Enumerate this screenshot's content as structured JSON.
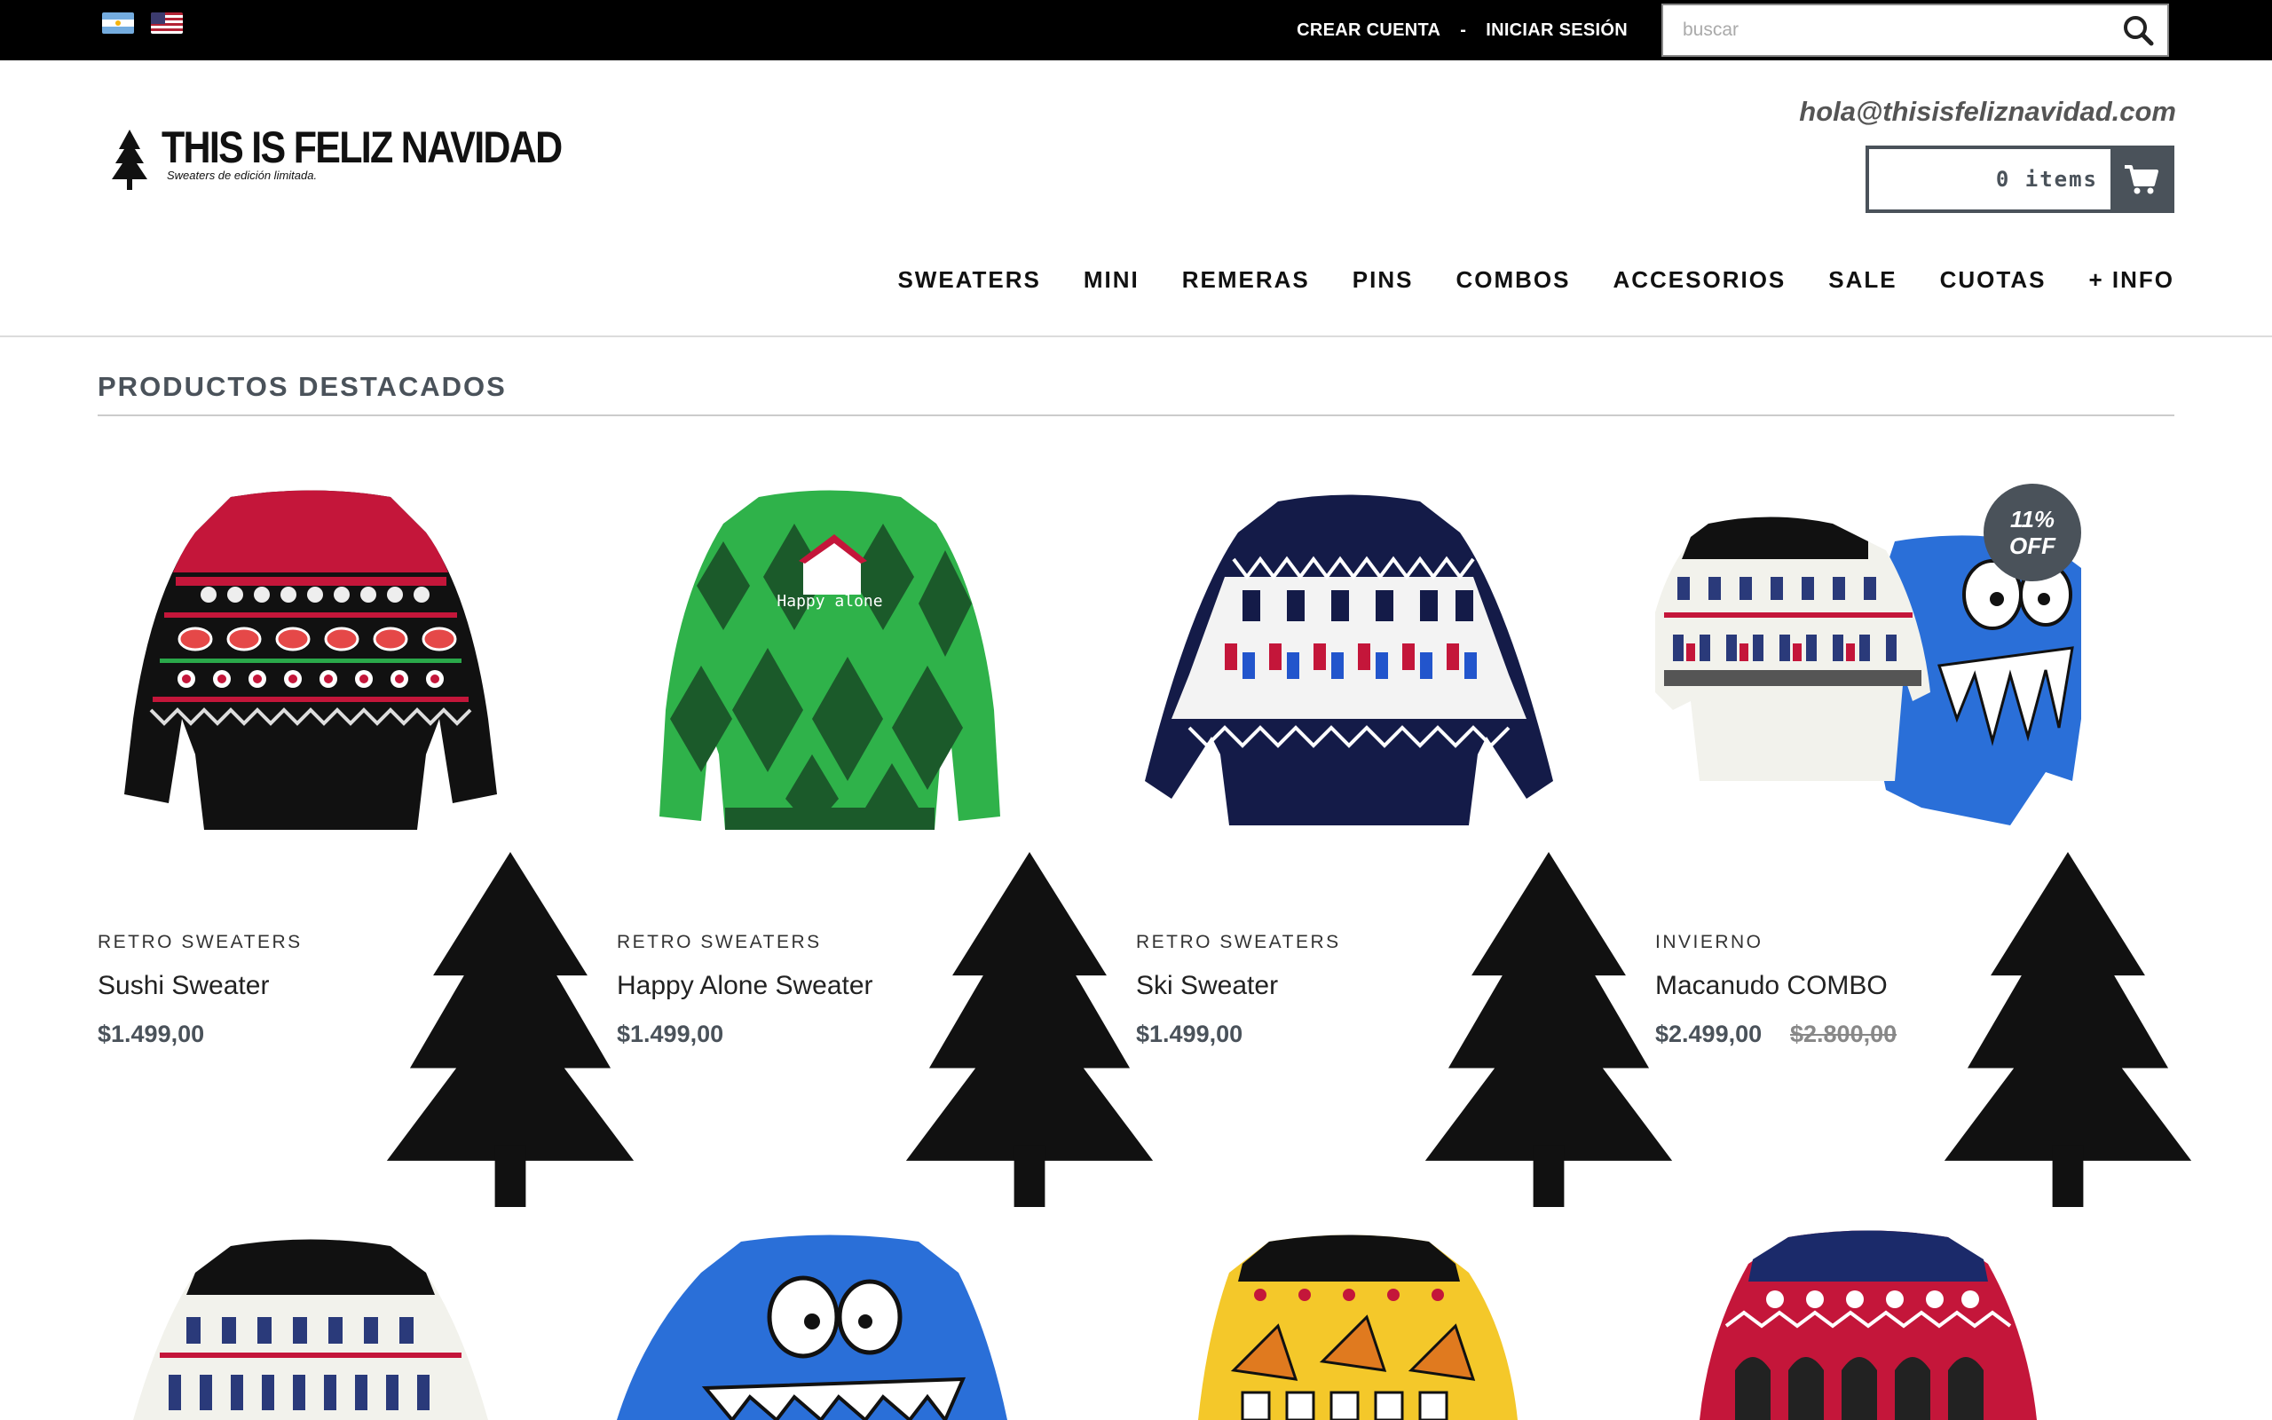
{
  "topbar": {
    "flags": [
      "argentina-flag-icon",
      "usa-flag-icon"
    ],
    "create_account": "CREAR CUENTA",
    "separator": "-",
    "login": "INICIAR SESIÓN",
    "search": {
      "placeholder": "buscar",
      "icon": "search-icon"
    }
  },
  "header": {
    "logo_title": "THIS IS FELIZ NAVIDAD",
    "logo_tagline": "Sweaters de edición limitada.",
    "email": "hola@thisisfeliznavidad.com",
    "cart": {
      "label": "0 items",
      "icon": "cart-icon"
    }
  },
  "nav": [
    "SWEATERS",
    "MINI",
    "REMERAS",
    "PINS",
    "COMBOS",
    "ACCESORIOS",
    "SALE",
    "CUOTAS",
    "+ INFO"
  ],
  "section": {
    "title": "PRODUCTOS DESTACADOS"
  },
  "products": [
    {
      "category": "RETRO SWEATERS",
      "name": "Sushi Sweater",
      "price": "$1.499,00"
    },
    {
      "category": "RETRO SWEATERS",
      "name": "Happy Alone Sweater",
      "price": "$1.499,00",
      "graphic_text": "Happy alone"
    },
    {
      "category": "RETRO SWEATERS",
      "name": "Ski Sweater",
      "price": "$1.499,00"
    },
    {
      "category": "INVIERNO",
      "name": "Macanudo COMBO",
      "price": "$2.499,00",
      "old_price": "$2.800,00",
      "badge": {
        "line1": "11%",
        "line2": "OFF"
      }
    }
  ],
  "colors": {
    "topbar": "#000000",
    "accent": "#4a525a",
    "text": "#222222",
    "muted": "#888888"
  }
}
